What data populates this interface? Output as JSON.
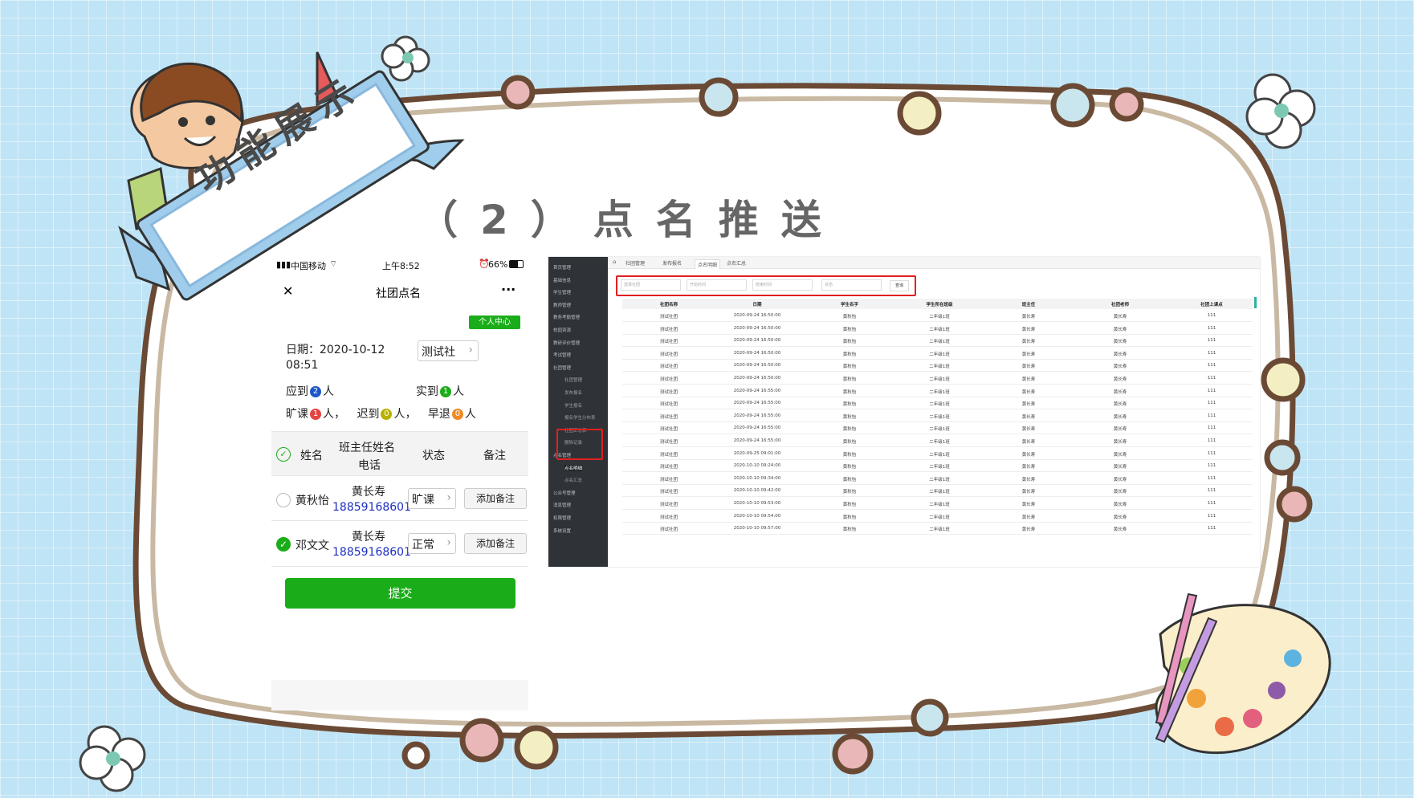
{
  "slide": {
    "title": "（2）点名推送",
    "banner": "功能展示"
  },
  "phone": {
    "status": {
      "carrier": "中国移动",
      "time": "上午8:52",
      "battery": "66%"
    },
    "nav": {
      "close": "✕",
      "title": "社团点名",
      "more": "···"
    },
    "personal_center": "个人中心",
    "date_label": "日期：2020-10-12",
    "date_time": "08:51",
    "club_select": "测试社",
    "should": {
      "label": "应到",
      "count": "2",
      "unit": "人"
    },
    "actual": {
      "label": "实到",
      "count": "1",
      "unit": "人"
    },
    "absent": {
      "label": "旷课",
      "count": "1",
      "unit": "人，"
    },
    "late": {
      "label": "迟到",
      "count": "0",
      "unit": "人，"
    },
    "early": {
      "label": "早退",
      "count": "0",
      "unit": "人"
    },
    "headers": {
      "name": "姓名",
      "teacher": "班主任姓名",
      "phone": "电话",
      "status": "状态",
      "note": "备注"
    },
    "rows": [
      {
        "name": "黄秋怡",
        "teacher": "黄长寿",
        "phone": "18859168601",
        "status": "旷课",
        "note": "添加备注"
      },
      {
        "name": "邓文文",
        "teacher": "黄长寿",
        "phone": "18859168601",
        "status": "正常",
        "note": "添加备注"
      }
    ],
    "submit": "提交"
  },
  "admin": {
    "sidebar": [
      "首页管理",
      "基础信息",
      "学生管理",
      "教师管理",
      "教务考勤管理",
      "校园资源",
      "教研评价管理",
      "考试管理",
      "社团管理",
      "社团管理",
      "发布报名",
      "学生报名",
      "报名学生分布表",
      "社团汇总表",
      "删除记录",
      "点名管理",
      "点名明细",
      "点名汇总",
      "公众号管理",
      "消息管理",
      "权限管理",
      "系统设置"
    ],
    "tabs": [
      "社团管理",
      "发布报名",
      "点名明细",
      "点名汇总"
    ],
    "query": {
      "club_placeholder": "选择社团",
      "start_placeholder": "开始时间",
      "end_placeholder": "结束时间",
      "status_placeholder": "状态",
      "search": "查询"
    },
    "columns": [
      "社团名称",
      "日期",
      "学生名字",
      "学生所在班级",
      "班主任",
      "社团老师",
      "社团上课点"
    ],
    "rows": [
      [
        "测试社团",
        "2020-09-24 16:50:00",
        "黄秋怡",
        "二年级1班",
        "黄长寿",
        "黄长寿",
        "111"
      ],
      [
        "测试社团",
        "2020-09-24 16:50:00",
        "黄秋怡",
        "二年级1班",
        "黄长寿",
        "黄长寿",
        "111"
      ],
      [
        "测试社团",
        "2020-09-24 16:50:00",
        "黄秋怡",
        "二年级1班",
        "黄长寿",
        "黄长寿",
        "111"
      ],
      [
        "测试社团",
        "2020-09-24 16:50:00",
        "黄秋怡",
        "二年级1班",
        "黄长寿",
        "黄长寿",
        "111"
      ],
      [
        "测试社团",
        "2020-09-24 16:50:00",
        "黄秋怡",
        "二年级1班",
        "黄长寿",
        "黄长寿",
        "111"
      ],
      [
        "测试社团",
        "2020-09-24 16:50:00",
        "黄秋怡",
        "二年级1班",
        "黄长寿",
        "黄长寿",
        "111"
      ],
      [
        "测试社团",
        "2020-09-24 16:55:00",
        "黄秋怡",
        "二年级1班",
        "黄长寿",
        "黄长寿",
        "111"
      ],
      [
        "测试社团",
        "2020-09-24 16:55:00",
        "黄秋怡",
        "二年级1班",
        "黄长寿",
        "黄长寿",
        "111"
      ],
      [
        "测试社团",
        "2020-09-24 16:55:00",
        "黄秋怡",
        "二年级1班",
        "黄长寿",
        "黄长寿",
        "111"
      ],
      [
        "测试社团",
        "2020-09-24 16:55:00",
        "黄秋怡",
        "二年级1班",
        "黄长寿",
        "黄长寿",
        "111"
      ],
      [
        "测试社团",
        "2020-09-24 16:55:00",
        "黄秋怡",
        "二年级1班",
        "黄长寿",
        "黄长寿",
        "111"
      ],
      [
        "测试社团",
        "2020-09-25 09:01:00",
        "黄秋怡",
        "二年级1班",
        "黄长寿",
        "黄长寿",
        "111"
      ],
      [
        "测试社团",
        "2020-10-10 09:24:00",
        "黄秋怡",
        "二年级1班",
        "黄长寿",
        "黄长寿",
        "111"
      ],
      [
        "测试社团",
        "2020-10-10 09:34:00",
        "黄秋怡",
        "二年级1班",
        "黄长寿",
        "黄长寿",
        "111"
      ],
      [
        "测试社团",
        "2020-10-10 09:42:00",
        "黄秋怡",
        "二年级1班",
        "黄长寿",
        "黄长寿",
        "111"
      ],
      [
        "测试社团",
        "2020-10-10 09:53:00",
        "黄秋怡",
        "二年级1班",
        "黄长寿",
        "黄长寿",
        "111"
      ],
      [
        "测试社团",
        "2020-10-10 09:54:00",
        "黄秋怡",
        "二年级1班",
        "黄长寿",
        "黄长寿",
        "111"
      ],
      [
        "测试社团",
        "2020-10-10 09:57:00",
        "黄秋怡",
        "二年级1班",
        "黄长寿",
        "黄长寿",
        "111"
      ]
    ]
  }
}
